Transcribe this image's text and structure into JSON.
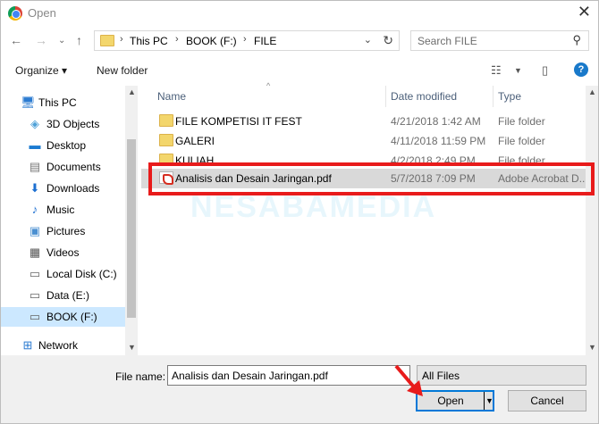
{
  "window": {
    "title": "Open"
  },
  "address": {
    "segments": [
      "This PC",
      "BOOK (F:)",
      "FILE"
    ]
  },
  "search": {
    "placeholder": "Search FILE"
  },
  "toolbar": {
    "organize": "Organize ▾",
    "new_folder": "New folder"
  },
  "sidebar": {
    "items": [
      {
        "label": "This PC",
        "icon": "computer-icon"
      },
      {
        "label": "3D Objects",
        "icon": "cube-icon"
      },
      {
        "label": "Desktop",
        "icon": "desktop-icon"
      },
      {
        "label": "Documents",
        "icon": "documents-icon"
      },
      {
        "label": "Downloads",
        "icon": "download-icon"
      },
      {
        "label": "Music",
        "icon": "music-icon"
      },
      {
        "label": "Pictures",
        "icon": "pictures-icon"
      },
      {
        "label": "Videos",
        "icon": "videos-icon"
      },
      {
        "label": "Local Disk (C:)",
        "icon": "drive-icon"
      },
      {
        "label": "Data (E:)",
        "icon": "drive-icon"
      },
      {
        "label": "BOOK (F:)",
        "icon": "drive-icon"
      },
      {
        "label": "Network",
        "icon": "network-icon"
      }
    ]
  },
  "columns": {
    "name": "Name",
    "date": "Date modified",
    "type": "Type"
  },
  "files": [
    {
      "name": "FILE  KOMPETISI IT FEST",
      "date": "4/21/2018 1:42 AM",
      "type": "File folder"
    },
    {
      "name": "GALERI",
      "date": "4/11/2018 11:59 PM",
      "type": "File folder"
    },
    {
      "name": "KULIAH",
      "date": "4/2/2018 2:49 PM",
      "type": "File folder"
    },
    {
      "name": "Analisis dan Desain Jaringan.pdf",
      "date": "5/7/2018 7:09 PM",
      "type": "Adobe Acrobat D..."
    }
  ],
  "watermark": "NESABAMEDIA",
  "bottom": {
    "file_name_label": "File name:",
    "file_name_value": "Analisis dan Desain Jaringan.pdf",
    "file_type": "All Files",
    "open_label": "Open",
    "cancel_label": "Cancel"
  },
  "colors": {
    "accent": "#0078d7",
    "highlight": "#e81b1b",
    "selected": "#cce8ff"
  }
}
